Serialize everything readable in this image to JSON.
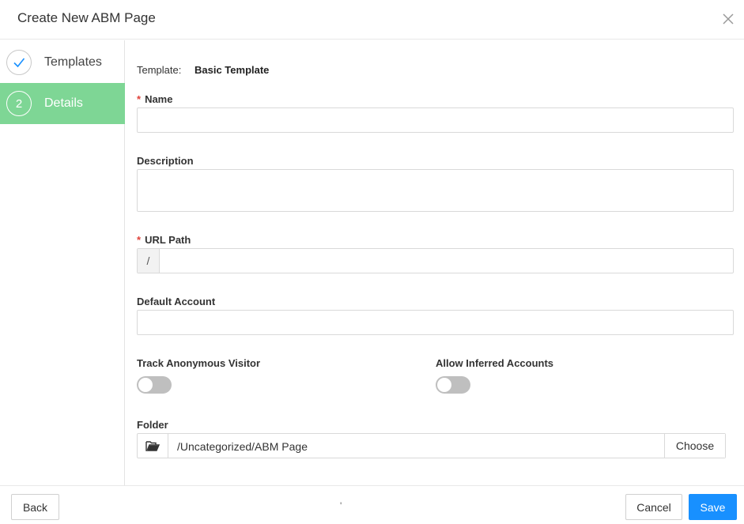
{
  "dialog": {
    "title": "Create New ABM Page"
  },
  "steps": [
    {
      "number": "",
      "label": "Templates",
      "status": "done"
    },
    {
      "number": "2",
      "label": "Details",
      "status": "active"
    }
  ],
  "form": {
    "template_label": "Template:",
    "template_value": "Basic Template",
    "required_mark": "*",
    "name_label": "Name",
    "name_value": "",
    "description_label": "Description",
    "description_value": "",
    "url_label": "URL Path",
    "url_prefix": "/",
    "url_value": "",
    "default_account_label": "Default Account",
    "default_account_value": "",
    "track_label": "Track Anonymous Visitor",
    "track_on": false,
    "inferred_label": "Allow Inferred Accounts",
    "inferred_on": false,
    "folder_label": "Folder",
    "folder_value": "/Uncategorized/ABM Page",
    "choose_label": "Choose"
  },
  "footer": {
    "back_label": "Back",
    "center_mark": "'",
    "cancel_label": "Cancel",
    "save_label": "Save"
  },
  "colors": {
    "accent": "#1890ff",
    "step_active": "#7ed695",
    "required": "#e0433b",
    "check": "#1890ff"
  },
  "icons": {
    "close": "close-icon",
    "check": "check-icon",
    "folder": "folder-open-icon"
  }
}
